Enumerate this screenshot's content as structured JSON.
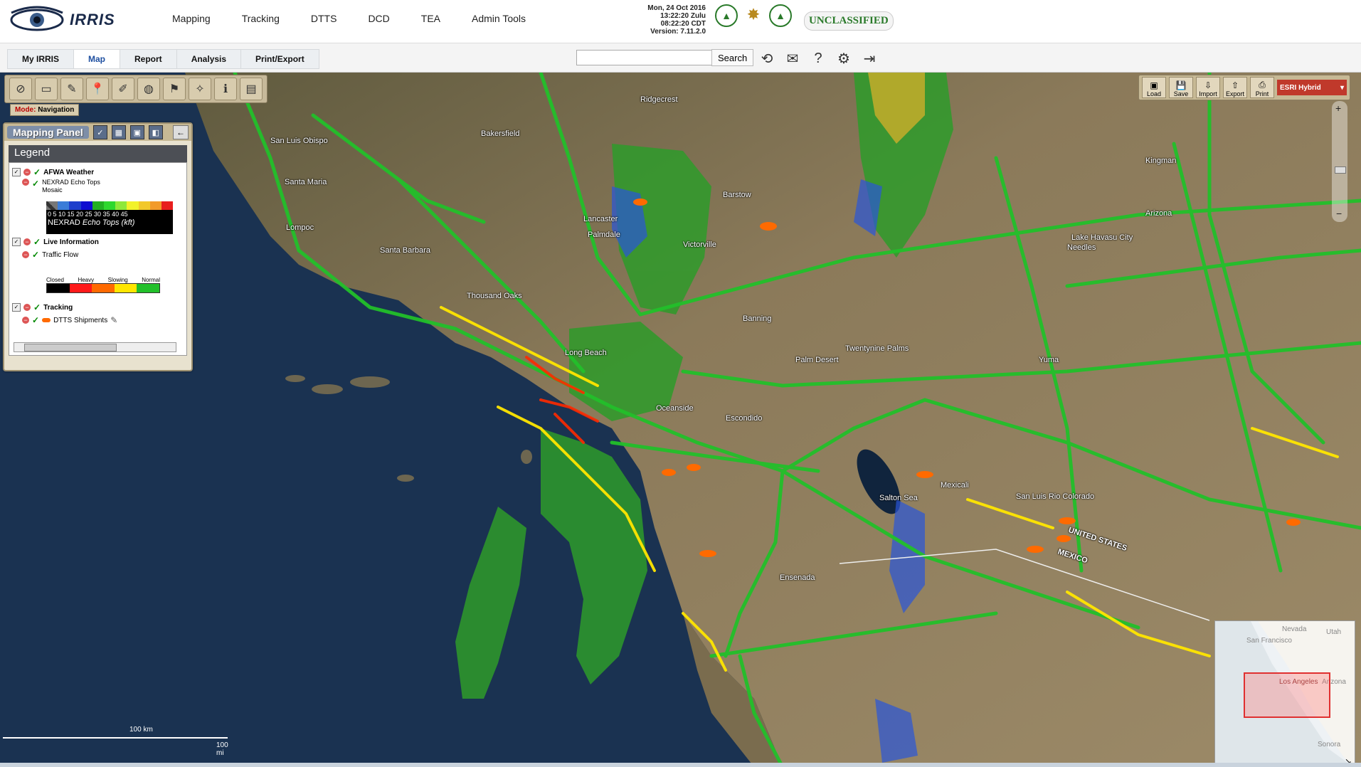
{
  "app": {
    "name": "IRRIS"
  },
  "nav": {
    "items": [
      "Mapping",
      "Tracking",
      "DTTS",
      "DCD",
      "TEA",
      "Admin Tools"
    ]
  },
  "clock": {
    "line1": "Mon, 24 Oct 2016",
    "line2": "13:22:20 Zulu",
    "line3": "08:22:20 CDT",
    "line4": "Version: 7.11.2.0"
  },
  "classification": "UNCLASSIFIED",
  "subtabs": {
    "items": [
      "My IRRIS",
      "Map",
      "Report",
      "Analysis",
      "Print/Export"
    ],
    "active": "Map"
  },
  "search": {
    "value": "",
    "button": "Search"
  },
  "mode": {
    "key": "Mode:",
    "value": "Navigation"
  },
  "panel": {
    "title": "Mapping Panel",
    "legend_title": "Legend",
    "weather_group": "AFWA Weather",
    "weather_layer_1": "NEXRAD Echo Tops",
    "weather_layer_2": "Mosaic",
    "echo_ticks": "0  5  10 15 20 25 30 35 40 45",
    "echo_caption": "NEXRAD",
    "echo_caption_units": "Echo Tops (kft)",
    "live_group": "Live Information",
    "traffic_layer": "Traffic Flow",
    "traffic_heads": [
      "Closed",
      "Heavy",
      "Slowing",
      "Normal"
    ],
    "tracking_group": "Tracking",
    "tracking_layer": "DTTS Shipments"
  },
  "right_tools": {
    "items": [
      "Load",
      "Save",
      "Import",
      "Export",
      "Print"
    ],
    "basemap": "ESRI Hybrid"
  },
  "map_labels": {
    "ridgecrest": "Ridgecrest",
    "lancaster": "Lancaster",
    "palmdale": "Palmdale",
    "victorville": "Victorville",
    "barstow": "Barstow",
    "bakersfield": "Bakersfield",
    "santa_maria": "Santa Maria",
    "san_luis": "San Luis Obispo",
    "santa_barbara": "Santa Barbara",
    "lompoc": "Lompoc",
    "thousand": "Thousand Oaks",
    "long_beach": "Long Beach",
    "oceanside": "Oceanside",
    "escondido": "Escondido",
    "banning": "Banning",
    "twentynine": "Twentynine Palms",
    "palm_desert": "Palm Desert",
    "salton": "Salton Sea",
    "mexicali": "Mexicali",
    "san_luis_rio": "San Luis Rio Colorado",
    "ensenada": "Ensenada",
    "arizona": "Arizona",
    "needles": "Needles",
    "lake_havasu": "Lake Havasu City",
    "yuma": "Yuma",
    "kingman": "Kingman",
    "united_states": "UNITED STATES",
    "mexico": "MEXICO"
  },
  "overview": {
    "san_francisco": "San Francisco",
    "los_angeles": "Los Angeles",
    "nevada": "Nevada",
    "utah": "Utah",
    "arizona": "Arizona",
    "sonora": "Sonora"
  },
  "scale": {
    "km": "100 km",
    "mi": "100 mi"
  },
  "colors": {
    "ocean": "#1a3251",
    "land": "#8b7a5a",
    "traffic_normal": "#22c02a",
    "traffic_slowing": "#ffe600",
    "traffic_heavy": "#ff2a00",
    "traffic_closed": "#000000",
    "weather_green": "#3fc23a",
    "weather_blue": "#2a55d8",
    "shipment": "#ff6a00"
  }
}
